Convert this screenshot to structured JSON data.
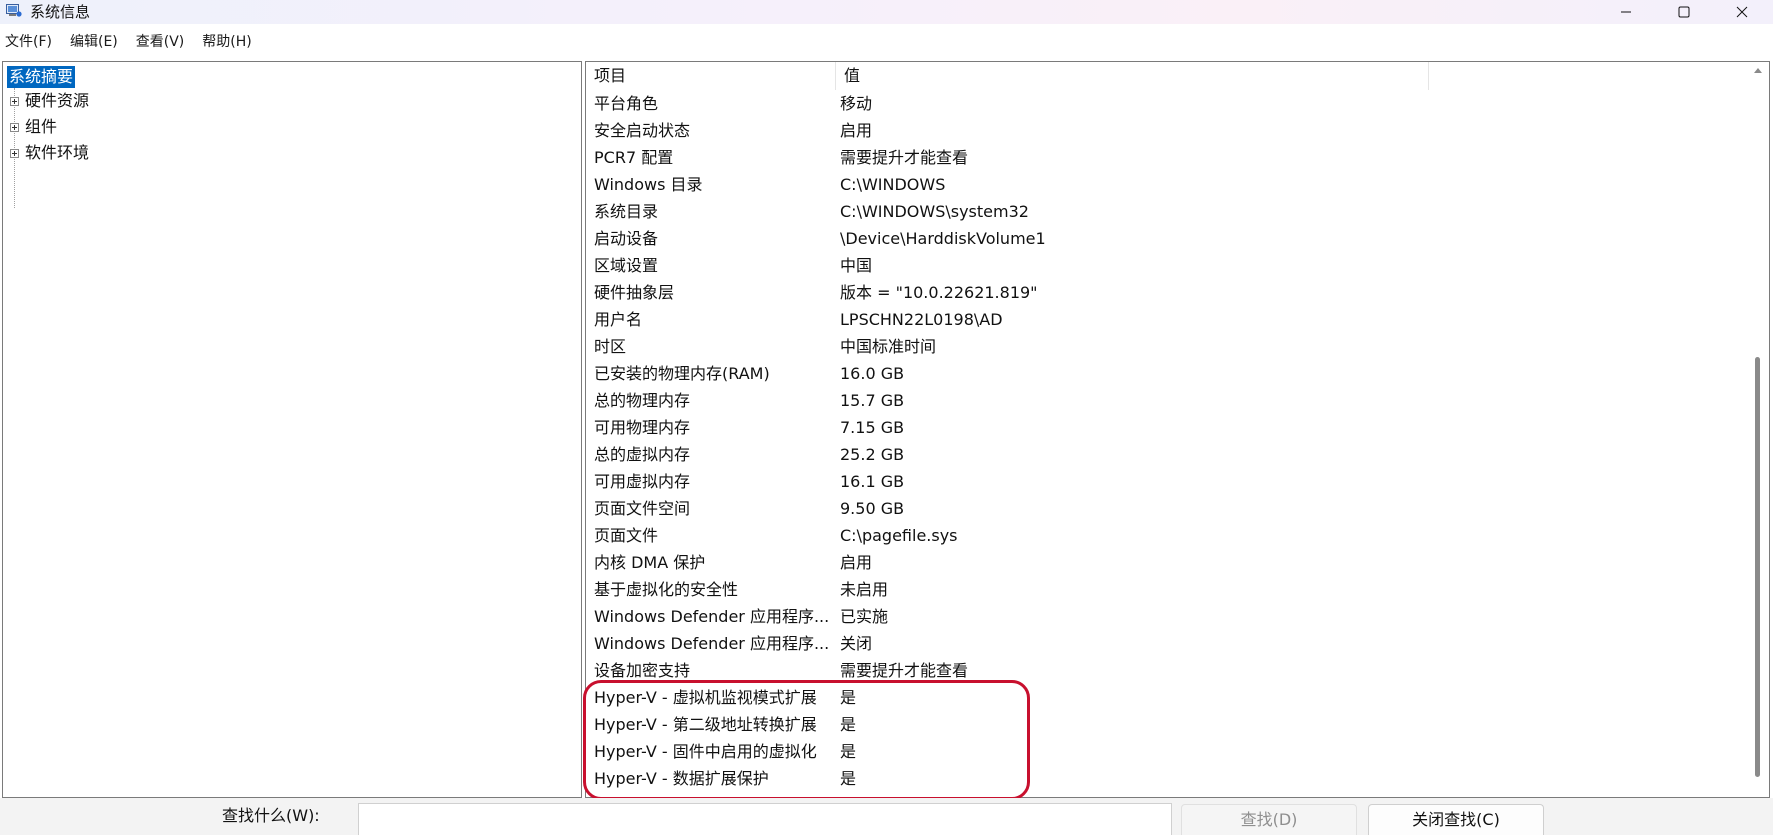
{
  "window": {
    "title": "系统信息"
  },
  "menu": [
    "文件(F)",
    "编辑(E)",
    "查看(V)",
    "帮助(H)"
  ],
  "tree": {
    "root": "系统摘要",
    "children": [
      "硬件资源",
      "组件",
      "软件环境"
    ]
  },
  "table": {
    "headers": [
      "项目",
      "值"
    ],
    "rows": [
      [
        "平台角色",
        "移动"
      ],
      [
        "安全启动状态",
        "启用"
      ],
      [
        "PCR7 配置",
        "需要提升才能查看"
      ],
      [
        "Windows 目录",
        "C:\\WINDOWS"
      ],
      [
        "系统目录",
        "C:\\WINDOWS\\system32"
      ],
      [
        "启动设备",
        "\\Device\\HarddiskVolume1"
      ],
      [
        "区域设置",
        "中国"
      ],
      [
        "硬件抽象层",
        "版本 = \"10.0.22621.819\""
      ],
      [
        "用户名",
        "LPSCHN22L0198\\AD"
      ],
      [
        "时区",
        "中国标准时间"
      ],
      [
        "已安装的物理内存(RAM)",
        "16.0 GB"
      ],
      [
        "总的物理内存",
        "15.7 GB"
      ],
      [
        "可用物理内存",
        "7.15 GB"
      ],
      [
        "总的虚拟内存",
        "25.2 GB"
      ],
      [
        "可用虚拟内存",
        "16.1 GB"
      ],
      [
        "页面文件空间",
        "9.50 GB"
      ],
      [
        "页面文件",
        "C:\\pagefile.sys"
      ],
      [
        "内核 DMA 保护",
        "启用"
      ],
      [
        "基于虚拟化的安全性",
        "未启用"
      ],
      [
        "Windows Defender 应用程序...",
        "已实施"
      ],
      [
        "Windows Defender 应用程序...",
        "关闭"
      ],
      [
        "设备加密支持",
        "需要提升才能查看"
      ],
      [
        "Hyper-V - 虚拟机监视模式扩展",
        "是"
      ],
      [
        "Hyper-V - 第二级地址转换扩展",
        "是"
      ],
      [
        "Hyper-V - 固件中启用的虚拟化",
        "是"
      ],
      [
        "Hyper-V - 数据扩展保护",
        "是"
      ]
    ]
  },
  "find": {
    "label": "查找什么(W):",
    "value": "",
    "find_button": "查找(D)",
    "close_find_button": "关闭查找(C)"
  },
  "colors": {
    "selection": "#0067c0",
    "annotation": "#c8102e"
  }
}
